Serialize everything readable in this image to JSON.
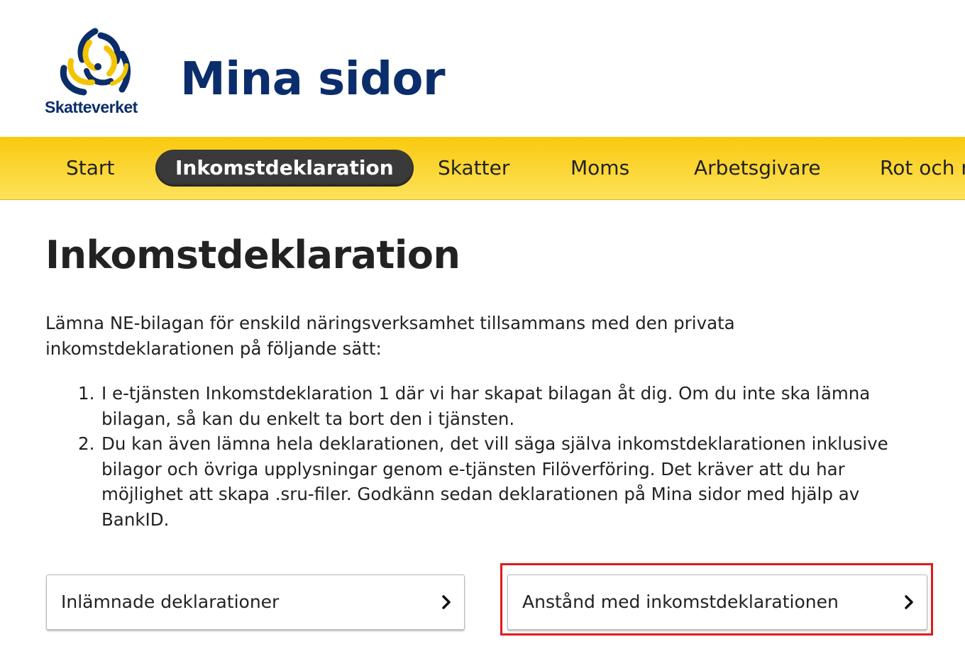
{
  "header": {
    "logo_text": "Skatteverket",
    "app_title": "Mina sidor"
  },
  "nav": {
    "items": [
      {
        "label": "Start",
        "active": false
      },
      {
        "label": "Inkomstdeklaration",
        "active": true
      },
      {
        "label": "Skatter",
        "active": false
      },
      {
        "label": "Moms",
        "active": false
      },
      {
        "label": "Arbetsgivare",
        "active": false
      },
      {
        "label": "Rot och r",
        "active": false
      }
    ]
  },
  "main": {
    "heading": "Inkomstdeklaration",
    "intro": "Lämna NE-bilagan för enskild näringsverksamhet tillsammans med den privata inkomstdeklarationen på följande sätt:",
    "steps": [
      {
        "number": "1.",
        "text": "I e-tjänsten Inkomstdeklaration 1 där vi har skapat bilagan åt dig. Om du inte ska lämna bilagan, så kan du enkelt ta bort den i tjänsten."
      },
      {
        "number": "2.",
        "text": "Du kan även lämna hela deklarationen, det vill säga själva inkomstdeklarationen inklusive bilagor och övriga upplysningar genom e-tjänsten Filöverföring. Det kräver att du har möjlighet att skapa .sru-filer. Godkänn sedan deklarationen på Mina sidor med hjälp av BankID."
      }
    ],
    "links": [
      {
        "label": "Inlämnade deklarationer",
        "icon": "chevron-right-icon"
      },
      {
        "label": "Anstånd med inkomstdeklarationen",
        "icon": "chevron-right-icon",
        "highlighted": true
      }
    ]
  },
  "colors": {
    "brand_blue": "#0b2d6b",
    "nav_yellow": "#f9c90e",
    "active_tab": "#3a3a3a",
    "highlight_red": "#e01b1b"
  }
}
